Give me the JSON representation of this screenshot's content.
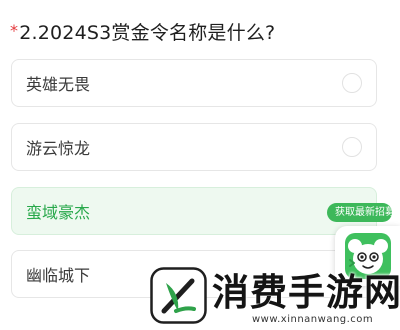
{
  "question": {
    "required_mark": "*",
    "text": "2.2024S3赏金令名称是什么?"
  },
  "options": [
    {
      "label": "英雄无畏",
      "selected": false
    },
    {
      "label": "游云惊龙",
      "selected": false
    },
    {
      "label": "蛮域豪杰",
      "selected": true
    },
    {
      "label": "幽临城下",
      "selected": false
    }
  ],
  "floating_widget": {
    "pill_text": "获取最新招募动态",
    "icon": "cartoon-mascot-icon"
  },
  "watermark": {
    "brand": "消费手游网",
    "url": "www.xinnanwang.com",
    "logo_icon": "leaf-logo-icon"
  },
  "colors": {
    "accent_green": "#27a84a",
    "selected_bg": "#eef9f0",
    "required_red": "#e4393c"
  }
}
